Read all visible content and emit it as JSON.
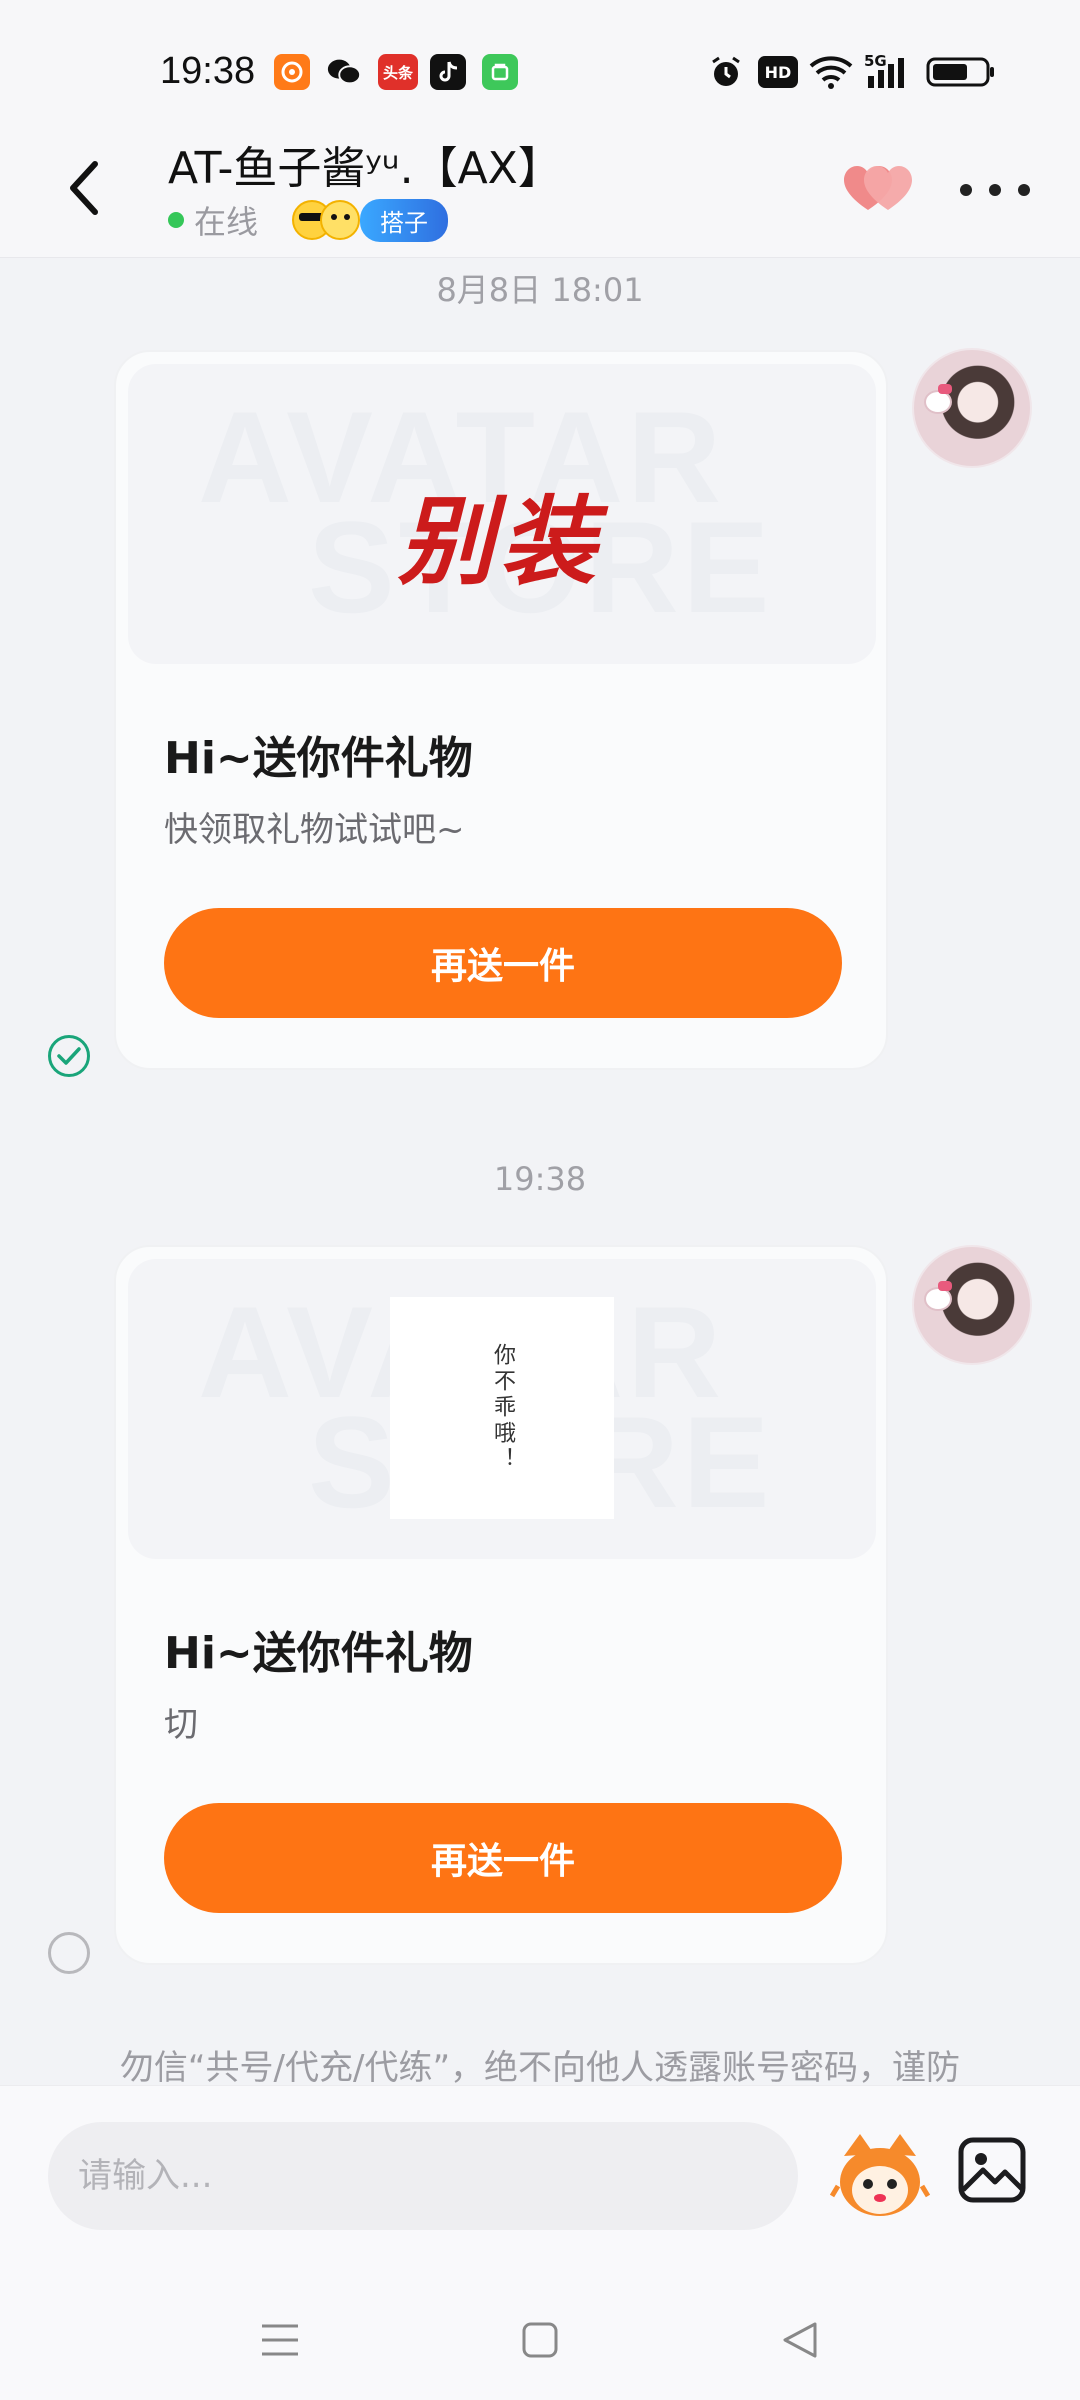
{
  "status_bar": {
    "time": "19:38",
    "notifications": [
      "app-orange-icon",
      "wechat-icon",
      "toutiao-icon",
      "tiktok-icon",
      "app-green-icon"
    ],
    "toutiao_label": "头条",
    "system": [
      "alarm-icon",
      "hd-icon",
      "wifi-icon",
      "5g-signal-icon",
      "battery-icon"
    ],
    "hd_label": "HD",
    "network_label": "5G"
  },
  "header": {
    "title": "AT-鱼子酱ʸᵘ.【AX】",
    "online": "在线",
    "tag": "搭子"
  },
  "messages": [
    {
      "timestamp": "8月8日 18:01",
      "gift_image_text": "别装",
      "watermark": [
        "AVATAR",
        "STORE"
      ],
      "title": "Hi~送你件礼物",
      "desc": "快领取礼物试试吧~",
      "button": "再送一件",
      "status": "delivered"
    },
    {
      "timestamp": "19:38",
      "gift_image_text": "你不乖哦！",
      "watermark": [
        "AVATAR",
        "STORE"
      ],
      "title": "Hi~送你件礼物",
      "desc": "切",
      "button": "再送一件",
      "status": "pending"
    }
  ],
  "safety_notice": "勿信“共号/代充/代练”，绝不向他人透露账号密码，谨防",
  "input": {
    "placeholder": "请输入..."
  },
  "colors": {
    "accent": "#fe7414",
    "online": "#35c759",
    "check": "#1aa57a"
  }
}
